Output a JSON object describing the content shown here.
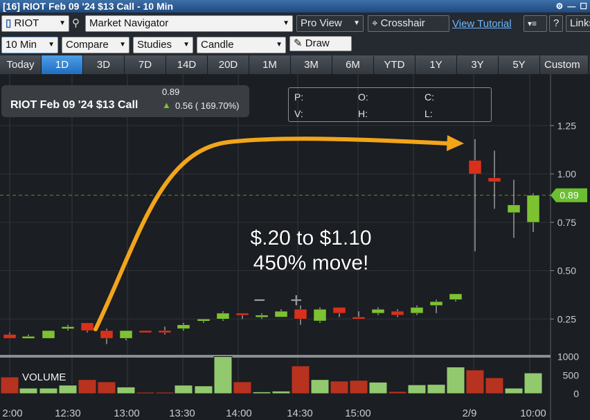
{
  "window": {
    "title": "[16] RIOT Feb 09 '24 $13 Call - 10 Min"
  },
  "toolbar1": {
    "symbol": "RIOT",
    "navigator": "Market Navigator",
    "view": "Pro View",
    "cursor": "Crosshair",
    "tutorial_link": "View Tutorial",
    "help": "?",
    "links": "Links"
  },
  "toolbar2": {
    "interval": "10 Min",
    "compare": "Compare",
    "studies": "Studies",
    "chart_type": "Candle",
    "draw": "Draw"
  },
  "ranges": [
    "Today",
    "1D",
    "3D",
    "7D",
    "14D",
    "20D",
    "1M",
    "3M",
    "6M",
    "YTD",
    "1Y",
    "3Y",
    "5Y",
    "Custom"
  ],
  "active_range": "1D",
  "quote": {
    "name": "RIOT Feb 09 '24 $13 Call",
    "last": "0.89",
    "change": "0.56 ( 169.70%)"
  },
  "ohlc": {
    "p": "P:",
    "o": "O:",
    "c": "C:",
    "v": "V:",
    "h": "H:",
    "l": "L:"
  },
  "annotation": {
    "line1": "$.20 to $1.10",
    "line2": "450% move!"
  },
  "zoom": {
    "minus": "−",
    "plus": "+"
  },
  "price_label": "0.89",
  "volume_label": "VOLUME",
  "colors": {
    "up": "#7dc230",
    "down": "#d9301c",
    "arrow": "#f2a51a",
    "price_tag": "#6cbf30"
  },
  "chart_data": {
    "type": "candlestick",
    "y_ticks": [
      "1.25",
      "1.00",
      "0.75",
      "0.50",
      "0.25"
    ],
    "volume_ticks": [
      "1000",
      "500",
      "0"
    ],
    "x_ticks": [
      "2:00",
      "12:30",
      "13:00",
      "13:30",
      "14:00",
      "14:30",
      "15:00",
      "2/9",
      "10:00"
    ],
    "ylim": [
      0,
      1.5
    ],
    "volume_ylim": [
      0,
      1000
    ],
    "last_price": 0.89,
    "candles": [
      {
        "o": 0.17,
        "h": 0.18,
        "l": 0.15,
        "c": 0.15,
        "v": 450
      },
      {
        "o": 0.16,
        "h": 0.17,
        "l": 0.15,
        "c": 0.16,
        "v": 150
      },
      {
        "o": 0.15,
        "h": 0.19,
        "l": 0.15,
        "c": 0.19,
        "v": 150
      },
      {
        "o": 0.2,
        "h": 0.22,
        "l": 0.19,
        "c": 0.21,
        "v": 230
      },
      {
        "o": 0.23,
        "h": 0.23,
        "l": 0.18,
        "c": 0.19,
        "v": 380
      },
      {
        "o": 0.19,
        "h": 0.2,
        "l": 0.12,
        "c": 0.15,
        "v": 320
      },
      {
        "o": 0.15,
        "h": 0.19,
        "l": 0.14,
        "c": 0.19,
        "v": 180
      },
      {
        "o": 0.19,
        "h": 0.19,
        "l": 0.18,
        "c": 0.18,
        "v": 40
      },
      {
        "o": 0.19,
        "h": 0.21,
        "l": 0.17,
        "c": 0.18,
        "v": 40
      },
      {
        "o": 0.2,
        "h": 0.23,
        "l": 0.19,
        "c": 0.22,
        "v": 230
      },
      {
        "o": 0.24,
        "h": 0.25,
        "l": 0.23,
        "c": 0.25,
        "v": 210
      },
      {
        "o": 0.25,
        "h": 0.29,
        "l": 0.24,
        "c": 0.28,
        "v": 1000
      },
      {
        "o": 0.28,
        "h": 0.28,
        "l": 0.25,
        "c": 0.27,
        "v": 320
      },
      {
        "o": 0.27,
        "h": 0.28,
        "l": 0.25,
        "c": 0.27,
        "v": 50
      },
      {
        "o": 0.26,
        "h": 0.3,
        "l": 0.26,
        "c": 0.29,
        "v": 70
      },
      {
        "o": 0.3,
        "h": 0.32,
        "l": 0.22,
        "c": 0.25,
        "v": 750
      },
      {
        "o": 0.24,
        "h": 0.31,
        "l": 0.23,
        "c": 0.3,
        "v": 380
      },
      {
        "o": 0.31,
        "h": 0.31,
        "l": 0.26,
        "c": 0.28,
        "v": 340
      },
      {
        "o": 0.26,
        "h": 0.29,
        "l": 0.25,
        "c": 0.25,
        "v": 360
      },
      {
        "o": 0.28,
        "h": 0.31,
        "l": 0.27,
        "c": 0.3,
        "v": 310
      },
      {
        "o": 0.29,
        "h": 0.3,
        "l": 0.26,
        "c": 0.27,
        "v": 60
      },
      {
        "o": 0.28,
        "h": 0.32,
        "l": 0.27,
        "c": 0.31,
        "v": 240
      },
      {
        "o": 0.32,
        "h": 0.35,
        "l": 0.28,
        "c": 0.34,
        "v": 250
      },
      {
        "o": 0.35,
        "h": 0.37,
        "l": 0.34,
        "c": 0.38,
        "v": 720
      },
      {
        "o": 1.07,
        "h": 1.18,
        "l": 0.6,
        "c": 1.0,
        "v": 640
      },
      {
        "o": 0.98,
        "h": 1.12,
        "l": 0.82,
        "c": 0.96,
        "v": 430
      },
      {
        "o": 0.8,
        "h": 0.97,
        "l": 0.67,
        "c": 0.84,
        "v": 150
      },
      {
        "o": 0.75,
        "h": 0.9,
        "l": 0.7,
        "c": 0.89,
        "v": 560
      }
    ]
  }
}
